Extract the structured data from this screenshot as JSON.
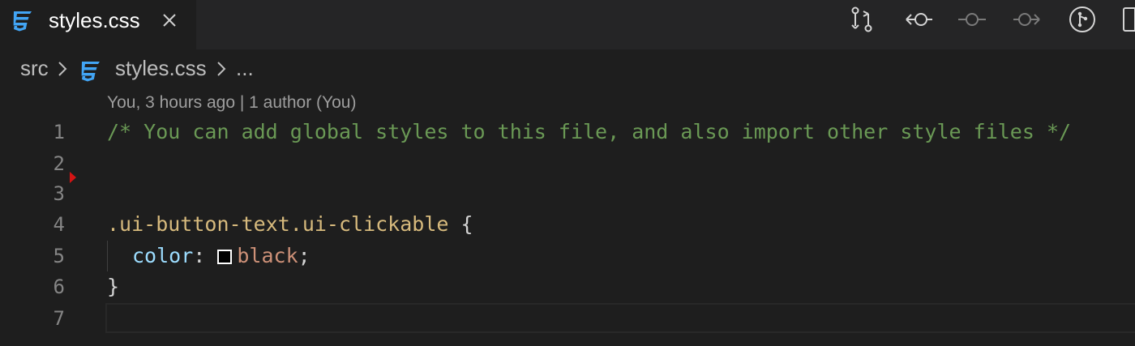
{
  "tab": {
    "filename": "styles.css",
    "icon": "css3-file-icon"
  },
  "toolbar": {
    "icons": [
      "open-changes-icon",
      "previous-change-icon",
      "commit-icon",
      "next-change-icon",
      "source-control-icon",
      "split-editor-icon"
    ]
  },
  "breadcrumb": {
    "folder": "src",
    "file": "styles.css",
    "more": "..."
  },
  "blame": "You, 3 hours ago | 1 author (You)",
  "editor": {
    "lines": [
      {
        "number": "1",
        "comment": "/* You can add global styles to this file, and also import other style files */"
      },
      {
        "number": "2"
      },
      {
        "number": "3"
      },
      {
        "number": "4",
        "selector": ".ui-button-text.ui-clickable",
        "open_brace": " {"
      },
      {
        "number": "5",
        "property": "color",
        "colon": ": ",
        "value": "black",
        "semicolon": ";"
      },
      {
        "number": "6",
        "close_brace": "}"
      },
      {
        "number": "7"
      }
    ]
  },
  "colors": {
    "comment": "#6a9955",
    "selector": "#d7ba7d",
    "property": "#9cdcfe",
    "value": "#ce9178",
    "swatch": "#000000",
    "diff_marker": "#d31414"
  }
}
